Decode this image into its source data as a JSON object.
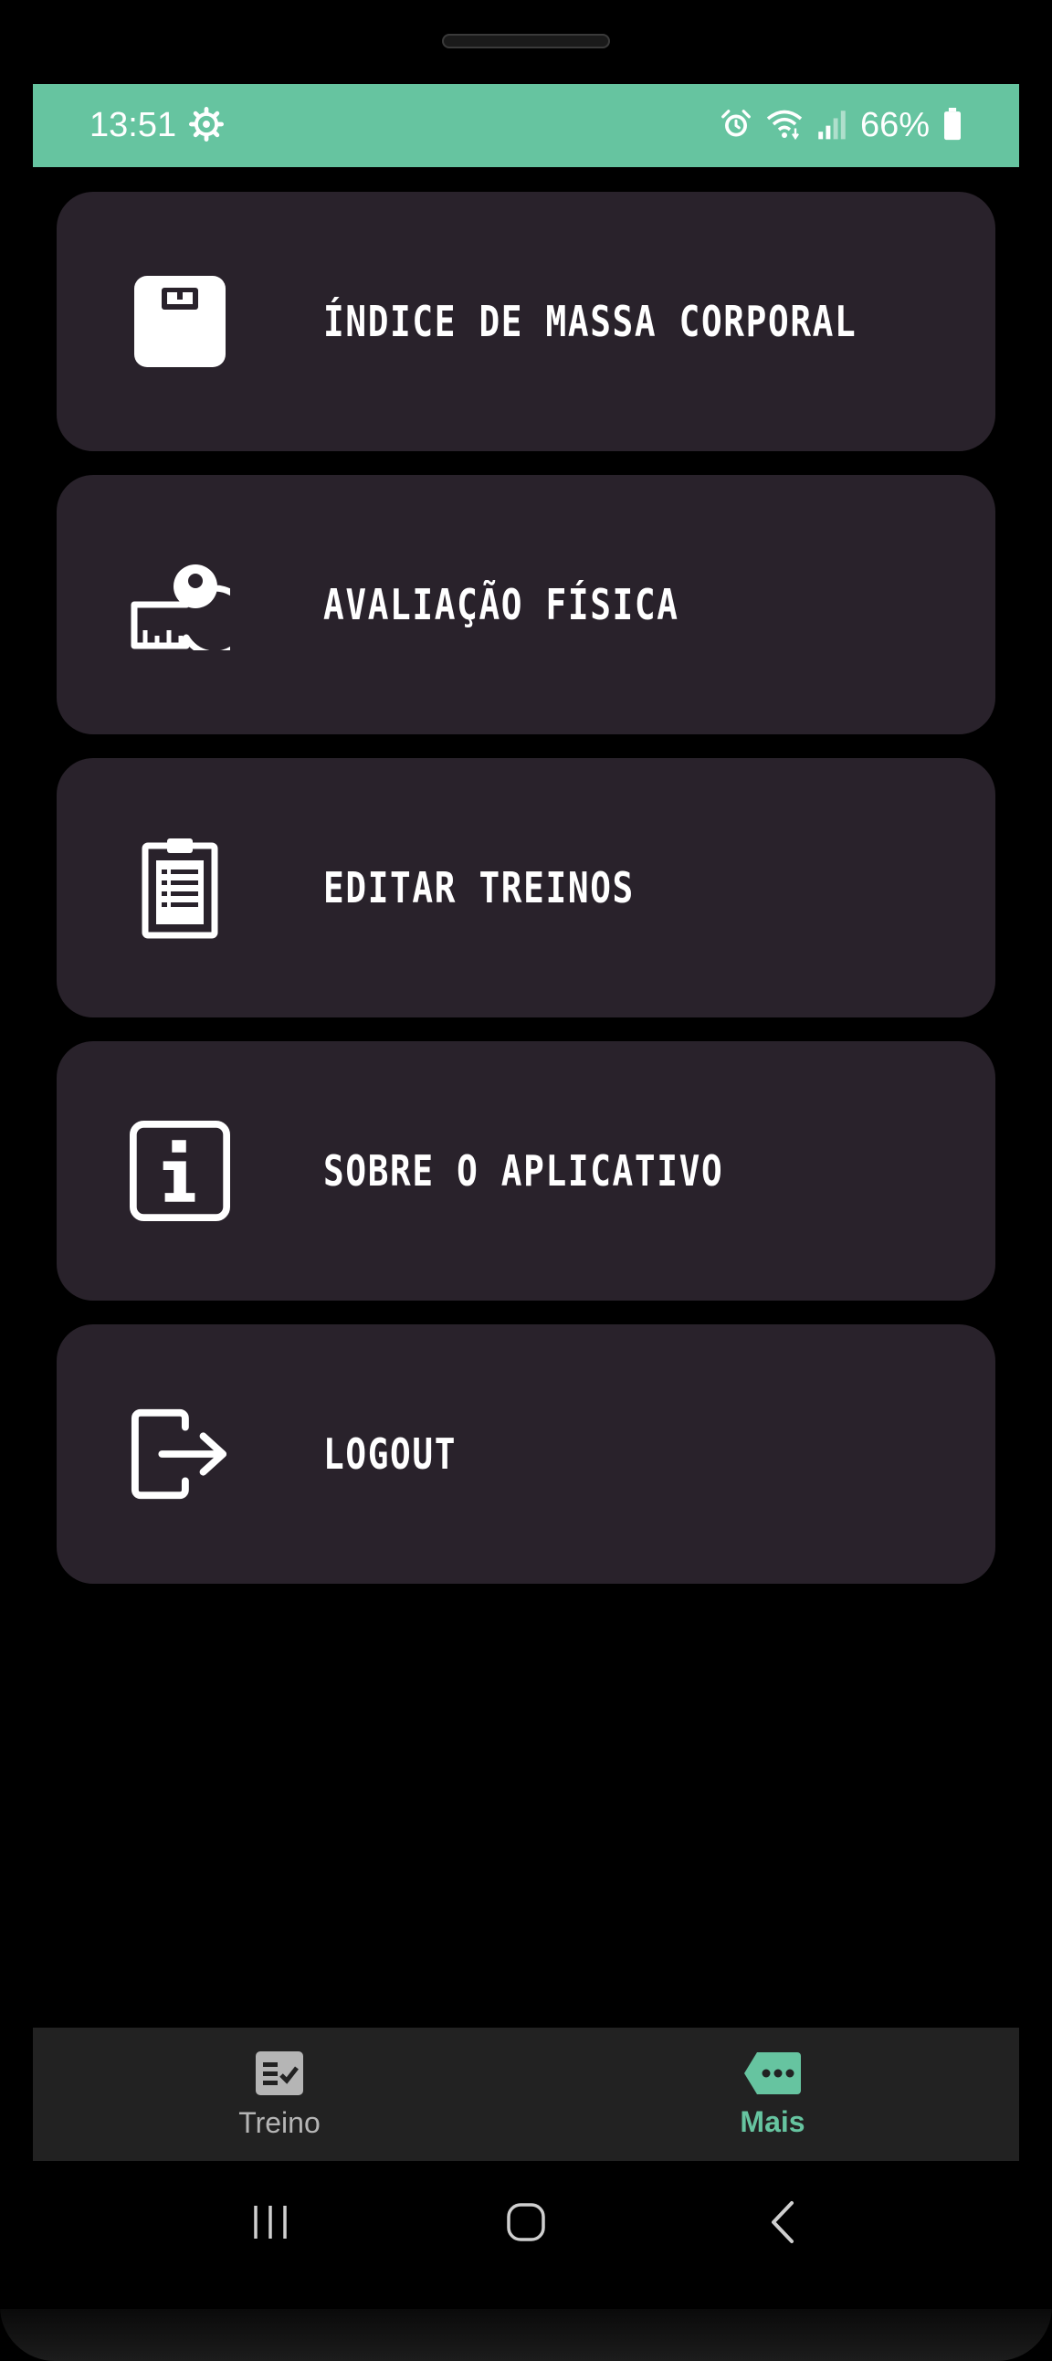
{
  "status_bar": {
    "time": "13:51",
    "battery": "66%"
  },
  "menu": {
    "items": [
      {
        "label": "ÍNDICE DE MASSA CORPORAL",
        "icon": "scale-icon"
      },
      {
        "label": "AVALIAÇÃO FÍSICA",
        "icon": "measuring-tape-icon"
      },
      {
        "label": "EDITAR TREINOS",
        "icon": "clipboard-list-icon"
      },
      {
        "label": "SOBRE O APLICATIVO",
        "icon": "info-icon"
      },
      {
        "label": "LOGOUT",
        "icon": "logout-icon"
      }
    ]
  },
  "bottom_nav": {
    "items": [
      {
        "label": "Treino",
        "icon": "checklist-icon",
        "active": false
      },
      {
        "label": "Mais",
        "icon": "more-tag-icon",
        "active": true
      }
    ]
  },
  "colors": {
    "accent": "#66c4a0",
    "card": "#29222b",
    "background": "#000000",
    "nav_background": "#222222"
  }
}
